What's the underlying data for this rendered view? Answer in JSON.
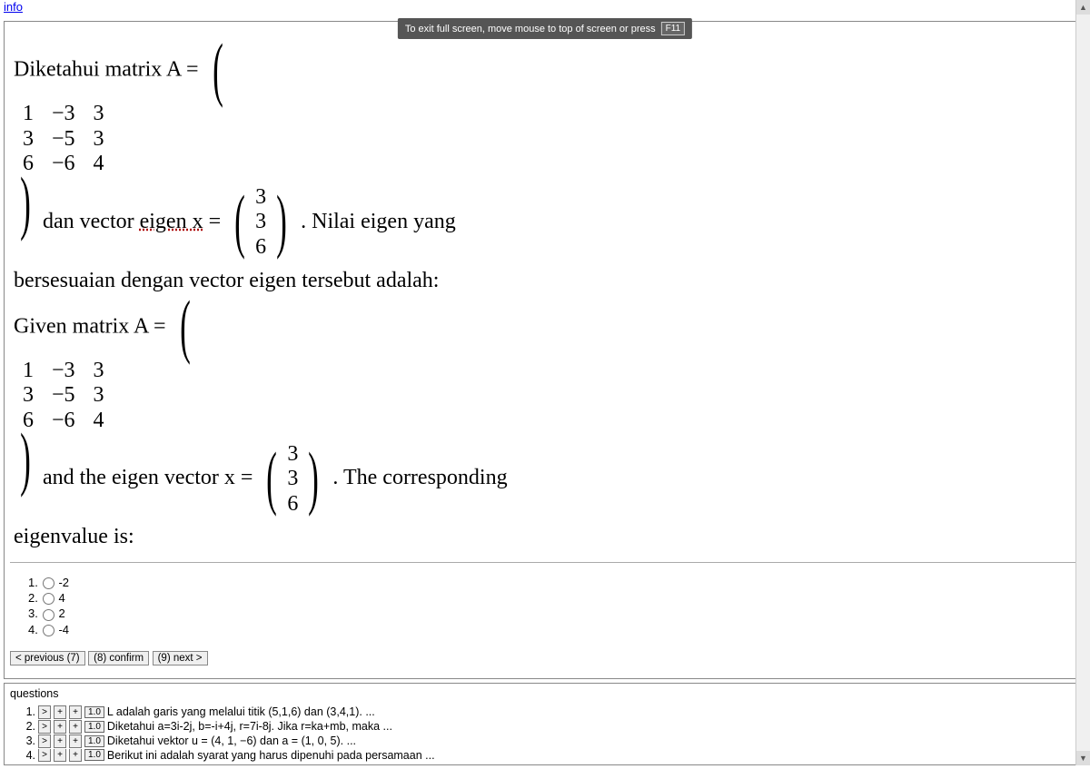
{
  "top_link": "info",
  "fs_tip": {
    "text": "To exit full screen, move mouse to top of screen or press",
    "key": "F11"
  },
  "question": {
    "id_part1": "Diketahui matrix A =",
    "id_part2": "dan vector",
    "id_eigen": "eigen x",
    "id_part3": "=",
    "id_part4": ". Nilai eigen yang",
    "id_part5": "bersesuaian dengan vector eigen tersebut adalah:",
    "en_part1": "Given matrix A =",
    "en_part2": "and the eigen vector x =",
    "en_part3": ". The corresponding",
    "en_part4": "eigenvalue is:",
    "matA": [
      [
        "1",
        "−3",
        "3"
      ],
      [
        "3",
        "−5",
        "3"
      ],
      [
        "6",
        "−6",
        "4"
      ]
    ],
    "vecX": [
      "3",
      "3",
      "6"
    ]
  },
  "options": [
    {
      "num": "1.",
      "label": "-2"
    },
    {
      "num": "2.",
      "label": "4"
    },
    {
      "num": "3.",
      "label": "2"
    },
    {
      "num": "4.",
      "label": "-4"
    }
  ],
  "nav": {
    "prev": "< previous (7)",
    "confirm": "(8) confirm",
    "next": "(9) next >"
  },
  "questions_panel": {
    "header": "questions",
    "goto": ">",
    "plus": "+",
    "items": [
      {
        "num": "1.",
        "score": "1.0",
        "text": "L adalah garis yang melalui titik (5,1,6) dan (3,4,1). ..."
      },
      {
        "num": "2.",
        "score": "1.0",
        "text": "Diketahui a=3i-2j, b=-i+4j, r=7i-8j. Jika r=ka+mb, maka ..."
      },
      {
        "num": "3.",
        "score": "1.0",
        "text": "Diketahui vektor u = (4, 1, −6) dan a = (1, 0, 5). ..."
      },
      {
        "num": "4.",
        "score": "1.0",
        "text": "Berikut ini adalah syarat yang harus dipenuhi pada persamaan ..."
      }
    ]
  }
}
